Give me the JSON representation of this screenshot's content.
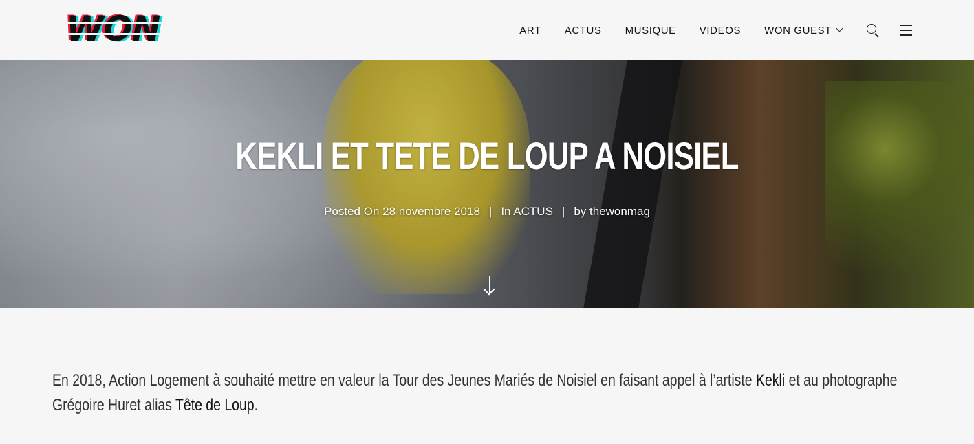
{
  "header": {
    "logo_text": "WON",
    "nav": [
      {
        "label": "ART"
      },
      {
        "label": "ACTUS"
      },
      {
        "label": "MUSIQUE"
      },
      {
        "label": "VIDEOS"
      },
      {
        "label": "WON GUEST",
        "has_dropdown": true
      }
    ],
    "icons": [
      "search-icon",
      "menu-icon"
    ]
  },
  "hero": {
    "title": "KEKLI ET TETE DE LOUP A NOISIEL",
    "meta": {
      "posted_label": "Posted On 28 novembre 2018",
      "separator": "|",
      "category_label": "In ACTUS",
      "author_label": "by thewonmag"
    },
    "scroll_icon": "arrow-down-icon"
  },
  "article": {
    "text_before_kekli": "En 2018, Action Logement à souhaité mettre en valeur la Tour des Jeunes Mariés de Noisiel en faisant appel à l’artiste ",
    "kekli": "Kekli",
    "text_middle": " et au photographe Grégoire Huret alias ",
    "tete_de_loup": "Tête de Loup",
    "text_end": "."
  },
  "colors": {
    "background": "#f6f6f6",
    "logo_cyan": "#19d4d8",
    "logo_red": "#e8203b",
    "logo_black": "#111111",
    "hero_text": "#ffffff"
  }
}
